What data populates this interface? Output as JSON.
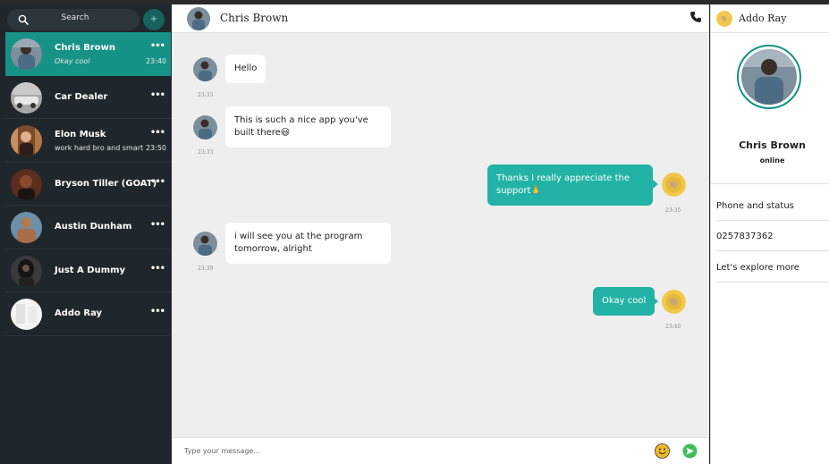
{
  "search": {
    "label": "Search",
    "add_label": "+"
  },
  "chats": [
    {
      "name": "Chris Brown",
      "preview": "Okay cool",
      "time": "23:40",
      "active": true
    },
    {
      "name": "Car Dealer",
      "preview": "",
      "time": ""
    },
    {
      "name": "Elon Musk",
      "preview": "work hard bro and smart",
      "time": "23:50"
    },
    {
      "name": "Bryson Tiller (GOAT)",
      "preview": "",
      "time": ""
    },
    {
      "name": "Austin Dunham",
      "preview": "",
      "time": ""
    },
    {
      "name": "Just A Dummy",
      "preview": "",
      "time": ""
    },
    {
      "name": "Addo Ray",
      "preview": "",
      "time": ""
    }
  ],
  "chat_header": {
    "name": "Chris Brown"
  },
  "messages": [
    {
      "direction": "in",
      "text": "Hello",
      "time": "23:33"
    },
    {
      "direction": "in",
      "text": "This is such a nice app you've built there😃",
      "time": "23:33"
    },
    {
      "direction": "out",
      "text": "Thanks I really appreciate the support🙏",
      "time": "23:35"
    },
    {
      "direction": "in",
      "text": "i will see you at the program tomorrow, alright",
      "time": "23:39"
    },
    {
      "direction": "out",
      "text": "Okay cool",
      "time": "23:40"
    }
  ],
  "composer": {
    "placeholder": "Type your message..."
  },
  "right_panel": {
    "header_name": "Addo Ray",
    "profile_name": "Chris Brown",
    "profile_status": "online",
    "items": [
      "Phone and status",
      "0257837362",
      "Let's explore more"
    ]
  },
  "colors": {
    "accent": "#169287",
    "bubble_out": "#22b3a6",
    "sidebar_bg": "#1f272c",
    "chat_bg": "#efeeef"
  }
}
